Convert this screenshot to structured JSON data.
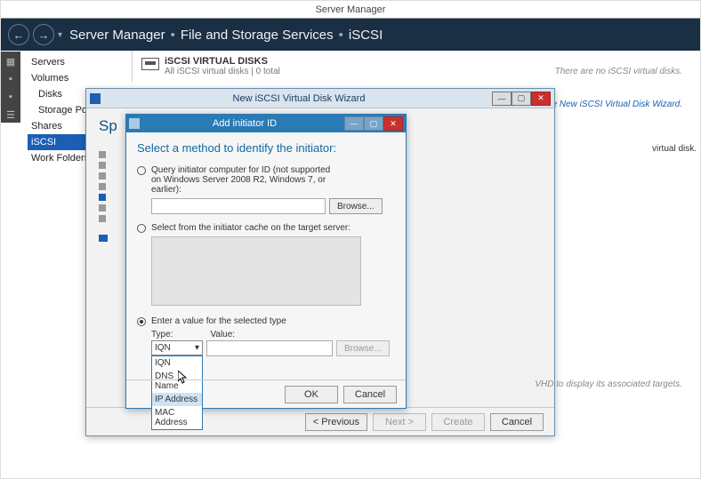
{
  "app_title": "Server Manager",
  "breadcrumb": {
    "a": "Server Manager",
    "b": "File and Storage Services",
    "c": "iSCSI"
  },
  "sidebar": {
    "items": [
      {
        "label": "Servers"
      },
      {
        "label": "Volumes"
      },
      {
        "label": "Disks"
      },
      {
        "label": "Storage Po…"
      },
      {
        "label": "Shares"
      },
      {
        "label": "iSCSI"
      },
      {
        "label": "Work Folders"
      }
    ],
    "selected_index": 5
  },
  "content_header": {
    "title": "iSCSI VIRTUAL DISKS",
    "subtitle": "All iSCSI virtual disks | 0 total"
  },
  "hints": {
    "no_disks": "There are no iSCSI virtual disks.",
    "start_wizard": "disk, start the New iSCSI Virtual Disk Wizard.",
    "vd_note": "virtual disk.",
    "targets": "VHD to display its associated targets."
  },
  "wizard": {
    "title": "New iSCSI Virtual Disk Wizard",
    "heading_prefix": "Sp",
    "footer": {
      "previous": "< Previous",
      "next": "Next >",
      "create": "Create",
      "cancel": "Cancel"
    }
  },
  "dialog": {
    "title": "Add initiator ID",
    "heading": "Select a method to identify the initiator:",
    "opt_query": "Query initiator computer for ID (not supported on Windows Server 2008 R2, Windows 7, or earlier):",
    "browse": "Browse...",
    "opt_cache": "Select from the initiator cache on the target server:",
    "opt_value": "Enter a value for the selected type",
    "type_label": "Type:",
    "value_label": "Value:",
    "type_selected": "IQN",
    "type_options": [
      "IQN",
      "DNS Name",
      "IP Address",
      "MAC Address"
    ],
    "type_hover_index": 2,
    "ok": "OK",
    "cancel": "Cancel"
  }
}
